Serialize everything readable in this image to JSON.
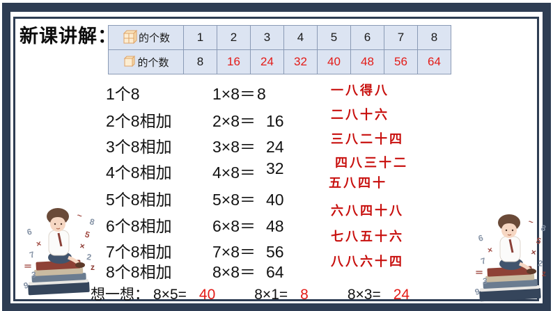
{
  "title": "新课讲解：",
  "table": {
    "row1": {
      "icon": "multi-cube-icon",
      "label": "的个数",
      "values": [
        "1",
        "2",
        "3",
        "4",
        "5",
        "6",
        "7",
        "8"
      ]
    },
    "row2": {
      "icon": "single-cube-icon",
      "label": "的个数",
      "values": [
        "8",
        "16",
        "24",
        "32",
        "40",
        "48",
        "56",
        "64"
      ]
    }
  },
  "equations": [
    {
      "label": "1个8",
      "expression": "1×8＝",
      "answer": "8"
    },
    {
      "label": "2个8相加",
      "expression": "2×8＝",
      "answer": "16"
    },
    {
      "label": "3个8相加",
      "expression": "3×8＝",
      "answer": "24"
    },
    {
      "label": "4个8相加",
      "expression": "4×8＝",
      "answer": "32"
    },
    {
      "label": "5个8相加",
      "expression": "5×8＝",
      "answer": "40"
    },
    {
      "label": "6个8相加",
      "expression": "6×8＝",
      "answer": "48"
    },
    {
      "label": "7个8相加",
      "expression": "7×8＝",
      "answer": "56"
    },
    {
      "label": "8个8相加",
      "expression": "8×8＝",
      "answer": "64"
    }
  ],
  "rhymes": [
    "一八得八",
    "二八十六",
    "三八二十四",
    "四八三十二",
    "五八四十",
    "六八四十八",
    "七八五十六",
    "八八六十四"
  ],
  "think": {
    "prompt": "想一想：",
    "items": [
      {
        "expression": "8×5=",
        "answer": "40"
      },
      {
        "expression": "8×1=",
        "answer": "8"
      },
      {
        "expression": "8×3=",
        "answer": "24"
      }
    ]
  },
  "illustration": {
    "name": "boy-sitting-on-books",
    "glyphs": [
      "6",
      "~",
      "8",
      "5",
      "×",
      "2",
      "z",
      "×",
      "7",
      "＝",
      "3",
      "9"
    ]
  },
  "colors": {
    "frame_navy": "#2e3d53",
    "table_bg": "#dce4f2",
    "table_border": "#8a9ab5",
    "answer_red": "#e31b17",
    "rhyme_red": "#c8100e"
  }
}
